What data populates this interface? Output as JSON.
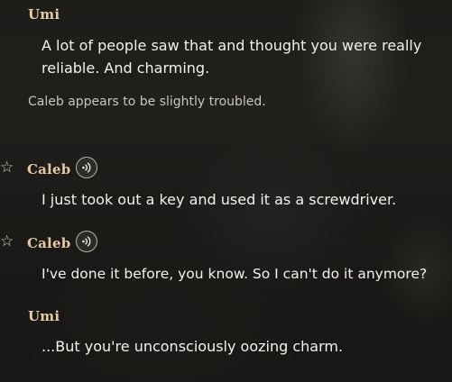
{
  "entries": [
    {
      "speaker": "Umi",
      "text_lines": [
        "A lot of people saw that and thought you were really",
        "reliable. And charming."
      ]
    },
    {
      "narration": "Caleb appears to be slightly troubled."
    },
    {
      "speaker": "Caleb",
      "text": "I just took out a key and used it as a screwdriver.",
      "favorite_icon": "star-outline-icon",
      "voice_icon": "voice-play-icon"
    },
    {
      "speaker": "Caleb",
      "text": "I've done it before, you know. So I can't do it anymore?",
      "favorite_icon": "star-outline-icon",
      "voice_icon": "voice-play-icon"
    },
    {
      "speaker": "Umi",
      "text": "...But you're unconsciously oozing charm."
    }
  ],
  "colors": {
    "speaker_name": "#e8c9a6",
    "dialogue_text": "#f4f1ec",
    "narration_text": "#c9c5bf"
  }
}
